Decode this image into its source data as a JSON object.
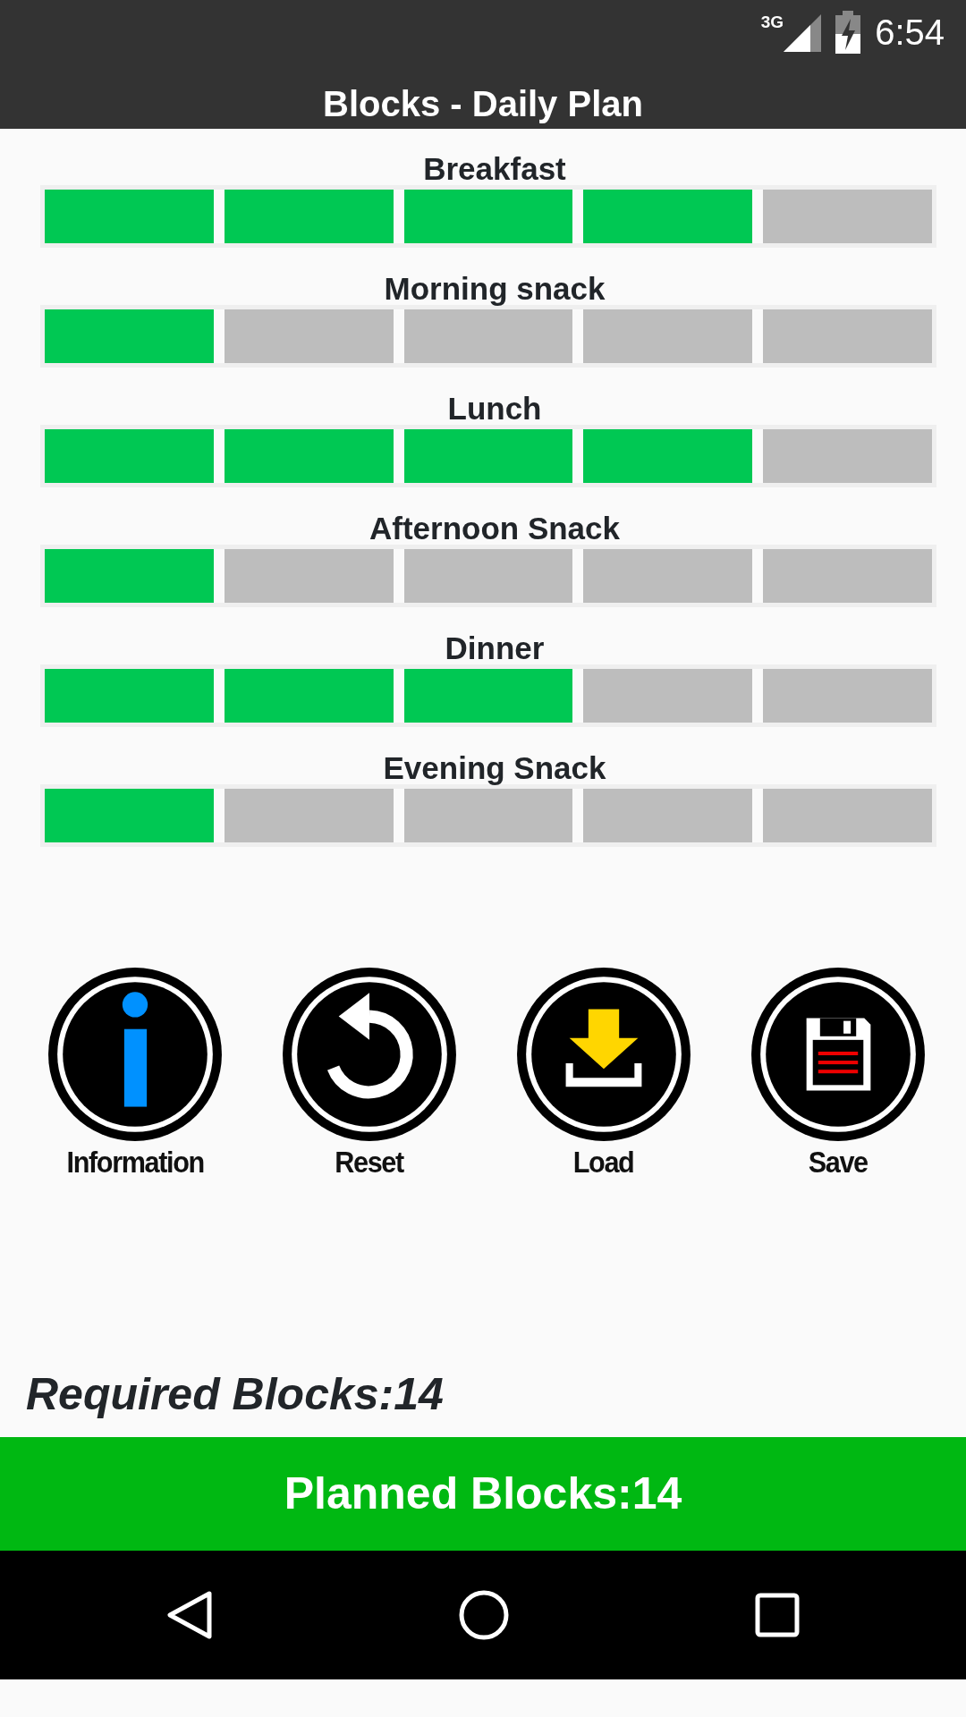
{
  "status_bar": {
    "network": "3G",
    "time": "6:54"
  },
  "app_bar": {
    "title": "Blocks - Daily Plan"
  },
  "meals": [
    {
      "name": "Breakfast",
      "blocks": [
        {
          "on": true
        },
        {
          "on": true
        },
        {
          "on": true
        },
        {
          "on": true
        },
        {
          "on": false
        }
      ]
    },
    {
      "name": "Morning snack",
      "blocks": [
        {
          "on": true
        },
        {
          "on": false
        },
        {
          "on": false
        },
        {
          "on": false
        },
        {
          "on": false
        }
      ]
    },
    {
      "name": "Lunch",
      "blocks": [
        {
          "on": true
        },
        {
          "on": true
        },
        {
          "on": true
        },
        {
          "on": true
        },
        {
          "on": false
        }
      ]
    },
    {
      "name": "Afternoon Snack",
      "blocks": [
        {
          "on": true
        },
        {
          "on": false
        },
        {
          "on": false
        },
        {
          "on": false
        },
        {
          "on": false
        }
      ]
    },
    {
      "name": "Dinner",
      "blocks": [
        {
          "on": true
        },
        {
          "on": true
        },
        {
          "on": true
        },
        {
          "on": false
        },
        {
          "on": false
        }
      ]
    },
    {
      "name": "Evening Snack",
      "blocks": [
        {
          "on": true
        },
        {
          "on": false
        },
        {
          "on": false
        },
        {
          "on": false
        },
        {
          "on": false
        }
      ]
    }
  ],
  "actions": [
    {
      "kind": "info",
      "label": "Information"
    },
    {
      "kind": "reset",
      "label": "Reset"
    },
    {
      "kind": "load",
      "label": "Load"
    },
    {
      "kind": "save",
      "label": "Save"
    }
  ],
  "required": "Required Blocks:14",
  "planned": "Planned Blocks:14"
}
